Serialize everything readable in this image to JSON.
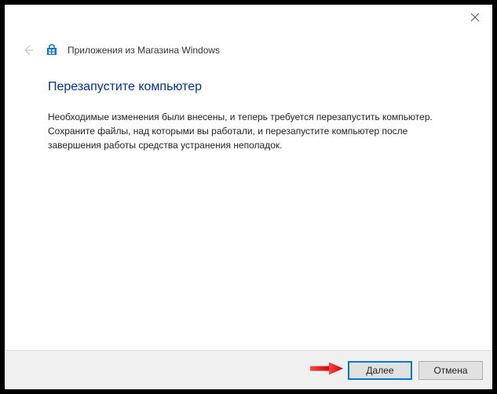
{
  "header": {
    "title": "Приложения из Магазина Windows"
  },
  "content": {
    "heading": "Перезапустите компьютер",
    "body": "Необходимые изменения были внесены, и теперь требуется перезапустить компьютер. Сохраните файлы, над которыми вы работали, и перезапустите компьютер после завершения работы средства устранения неполадок."
  },
  "footer": {
    "next_label": "Далее",
    "cancel_label": "Отмена"
  }
}
